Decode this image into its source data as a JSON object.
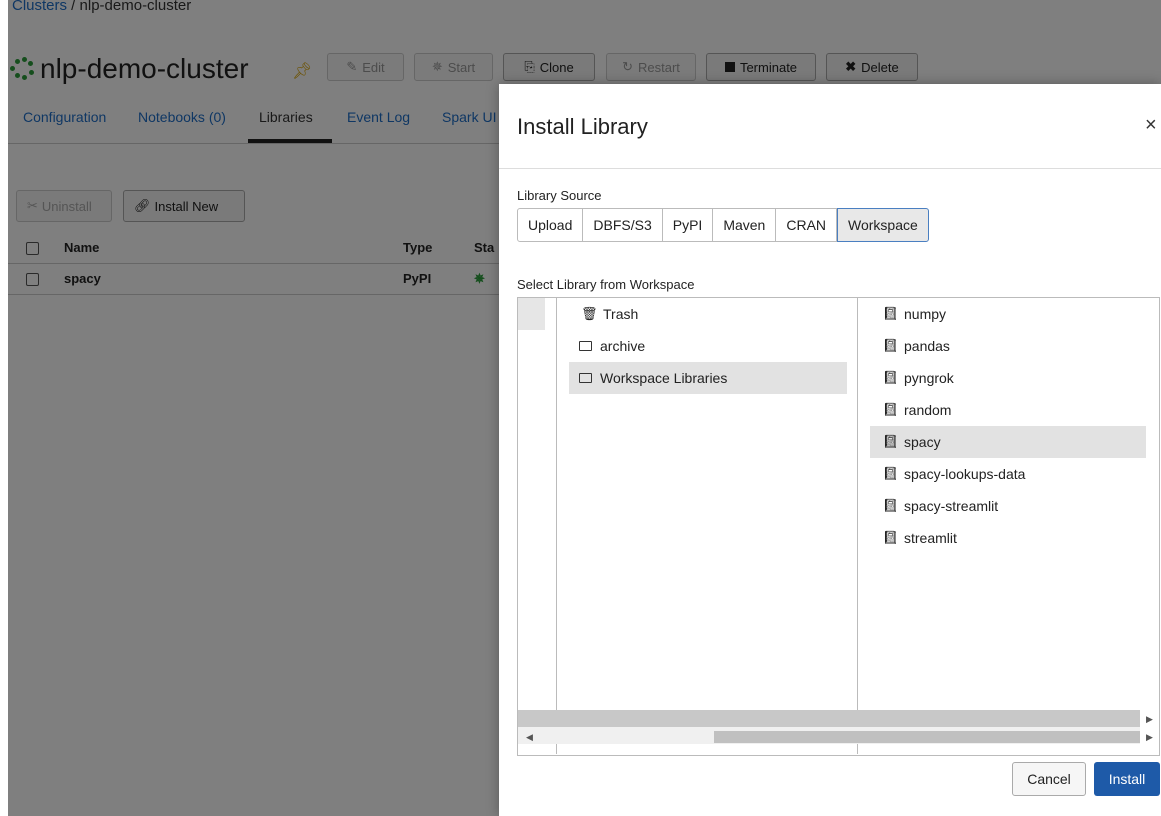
{
  "breadcrumb": {
    "clusters": "Clusters",
    "separator": " / ",
    "current": "nlp-demo-cluster"
  },
  "cluster": {
    "name": "nlp-demo-cluster",
    "status_color": "#2a9d3a"
  },
  "toolbar": {
    "edit": "Edit",
    "start": "Start",
    "clone": "Clone",
    "restart": "Restart",
    "terminate": "Terminate",
    "delete": "Delete"
  },
  "tabs": [
    "Configuration",
    "Notebooks (0)",
    "Libraries",
    "Event Log",
    "Spark UI"
  ],
  "libraries_toolbar": {
    "uninstall": "Uninstall",
    "install_new": "Install New"
  },
  "library_table": {
    "headers": {
      "name": "Name",
      "type": "Type",
      "status": "Sta"
    },
    "rows": [
      {
        "name": "spacy",
        "type": "PyPI"
      }
    ]
  },
  "modal": {
    "title": "Install Library",
    "close": "×",
    "source_label": "Library Source",
    "sources": [
      "Upload",
      "DBFS/S3",
      "PyPI",
      "Maven",
      "CRAN",
      "Workspace"
    ],
    "selected_source": "Workspace",
    "workspace_label": "Select Library from Workspace",
    "folders": [
      {
        "label": "Trash",
        "icon": "trash-icon"
      },
      {
        "label": "archive",
        "icon": "folder-icon"
      },
      {
        "label": "Workspace Libraries",
        "icon": "folder-icon"
      }
    ],
    "libraries": [
      "numpy",
      "pandas",
      "pyngrok",
      "random",
      "spacy",
      "spacy-lookups-data",
      "spacy-streamlit",
      "streamlit"
    ],
    "selected_library": "spacy",
    "cancel": "Cancel",
    "install": "Install",
    "primary_color": "#1e5aa8"
  }
}
